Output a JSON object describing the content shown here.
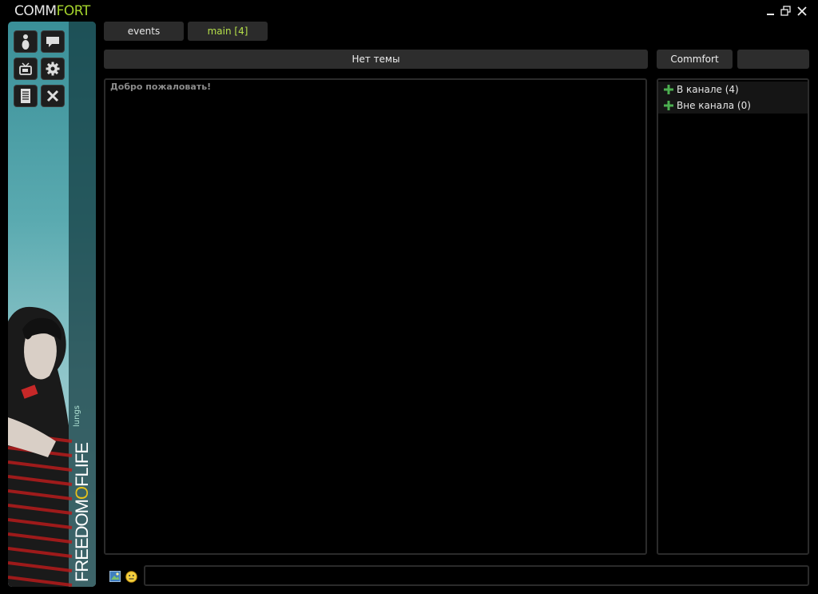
{
  "app": {
    "logo_main": "COMM",
    "logo_accent": "FORT"
  },
  "tabs": [
    {
      "label": "events"
    },
    {
      "label": "main [4]"
    }
  ],
  "topic": {
    "label": "Нет темы"
  },
  "channel_header": {
    "label": "Commfort"
  },
  "chat": {
    "welcome": "Добро пожаловать!"
  },
  "users": {
    "groups": [
      {
        "label": "В канале (4)"
      },
      {
        "label": "Вне канала (0)"
      }
    ]
  },
  "sidebar": {
    "buttons": [
      {
        "icon": "user-info-icon"
      },
      {
        "icon": "chat-bubble-icon"
      },
      {
        "icon": "tv-icon"
      },
      {
        "icon": "gear-icon"
      },
      {
        "icon": "notes-icon"
      },
      {
        "icon": "close-icon"
      }
    ],
    "brand_text_1": "FREEDOM",
    "brand_text_o": "O",
    "brand_text_2": "FLIFE",
    "side_caption": "lungs"
  },
  "colors": {
    "accent_green": "#a4d32c",
    "background": "#000000",
    "panel_border": "#2b2b2b"
  }
}
